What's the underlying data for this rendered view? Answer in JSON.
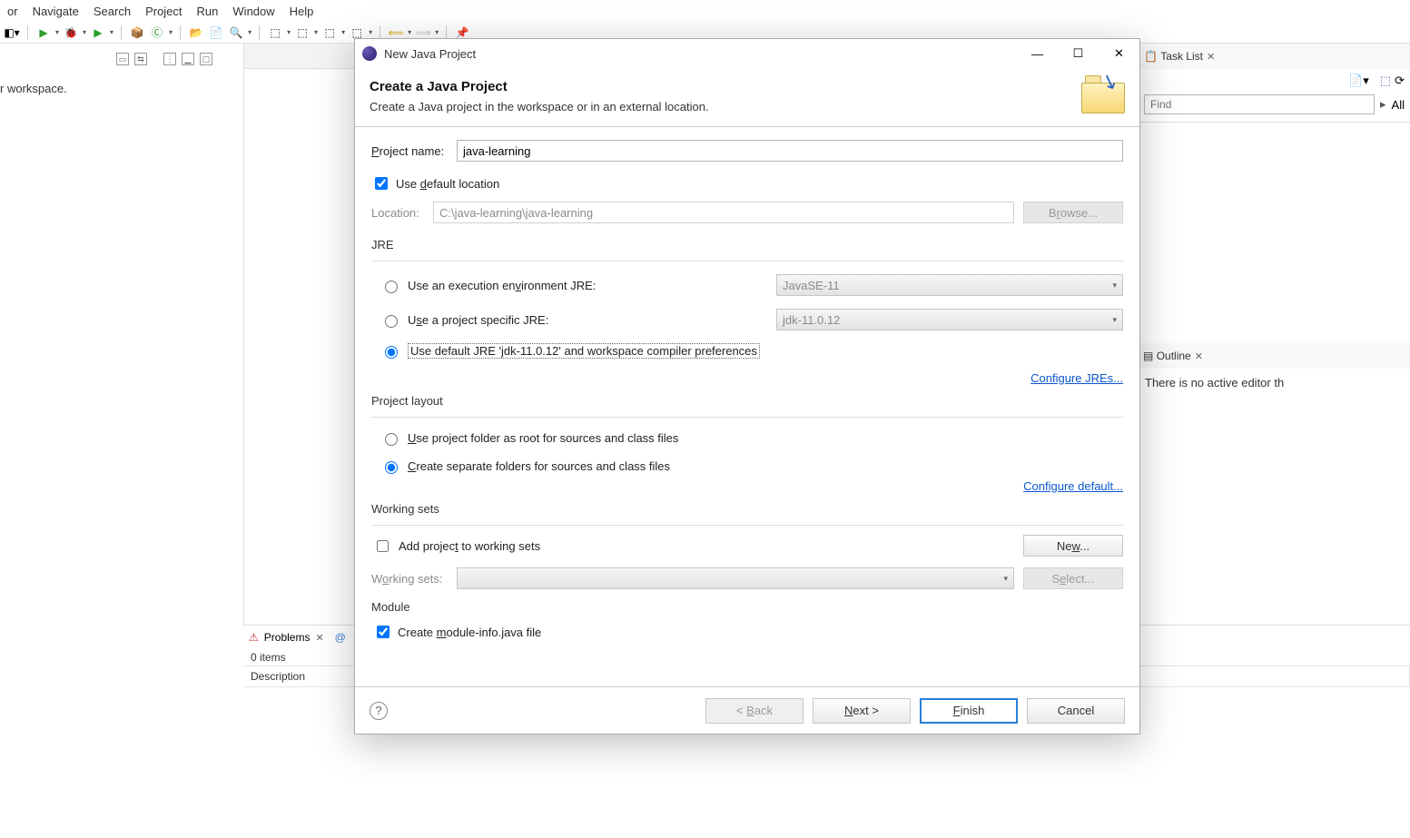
{
  "menu": {
    "items": [
      "or",
      "Navigate",
      "Search",
      "Project",
      "Run",
      "Window",
      "Help"
    ]
  },
  "left_area": {
    "text": "r workspace."
  },
  "right": {
    "task_list_title": "Task List",
    "find_placeholder": "Find",
    "find_all": "All",
    "outline_title": "Outline",
    "outline_text": "There is no active editor th"
  },
  "problems": {
    "tab": "Problems",
    "status": "0 items",
    "col_desc": "Description"
  },
  "dialog": {
    "window_title": "New Java Project",
    "heading": "Create a Java Project",
    "subheading": "Create a Java project in the workspace or in an external location.",
    "project_name_label": "Project name:",
    "project_name_value": "java-learning",
    "use_default_loc": "Use default location",
    "location_label": "Location:",
    "location_value": "C:\\java-learning\\java-learning",
    "browse": "Browse...",
    "jre_group": "JRE",
    "jre_opt1": "Use an execution environment JRE:",
    "jre_opt1_value": "JavaSE-11",
    "jre_opt2": "Use a project specific JRE:",
    "jre_opt2_value": "jdk-11.0.12",
    "jre_opt3": "Use default JRE 'jdk-11.0.12' and workspace compiler preferences",
    "jre_configure": "Configure JREs...",
    "layout_group": "Project layout",
    "layout_opt1": "Use project folder as root for sources and class files",
    "layout_opt2": "Create separate folders for sources and class files",
    "layout_configure": "Configure default...",
    "ws_group": "Working sets",
    "ws_check": "Add project to working sets",
    "ws_new": "New...",
    "ws_label": "Working sets:",
    "ws_select": "Select...",
    "module_group": "Module",
    "module_check": "Create module-info.java file",
    "btn_back": "< Back",
    "btn_next": "Next >",
    "btn_finish": "Finish",
    "btn_cancel": "Cancel"
  }
}
